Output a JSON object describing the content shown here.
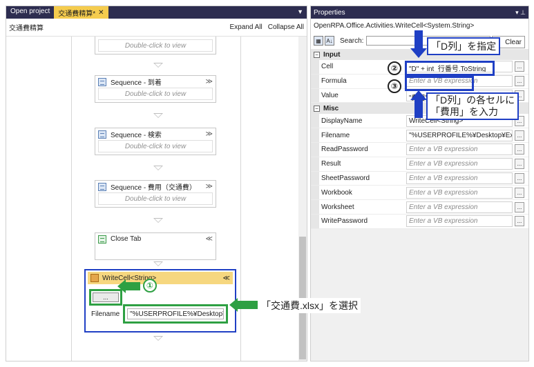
{
  "designer": {
    "tabs": [
      {
        "label": "Open project",
        "active": false
      },
      {
        "label": "交通費精算*",
        "active": true,
        "close": "✕"
      }
    ],
    "tab_dropdown": "▼",
    "breadcrumb": "交通費精算",
    "expand_all": "Expand All",
    "collapse_all": "Collapse All",
    "placeholder": "Double-click to view",
    "activities": [
      {
        "title": "",
        "body": "Double-click to view",
        "chevron": ""
      },
      {
        "title": "Sequence - 到着",
        "body": "Double-click to view",
        "chevron": "≫"
      },
      {
        "title": "Sequence - 検索",
        "body": "Double-click to view",
        "chevron": "≫"
      },
      {
        "title": "Sequence - 費用（交通費）",
        "body": "Double-click to view",
        "chevron": "≫"
      },
      {
        "title": "Close Tab",
        "body": "",
        "chevron": "≪"
      }
    ],
    "writecell": {
      "title": "WriteCell<String>",
      "chevron": "≪",
      "browse_label": "...",
      "filename_label": "Filename",
      "filename_value": "\"%USERPROFILE%¥Desktop¥Exc"
    }
  },
  "properties": {
    "title": "Properties",
    "pin": "▾ ⊥",
    "type_name": "OpenRPA.Office.Activities.WriteCell<System.String>",
    "search_label": "Search:",
    "clear_label": "Clear",
    "categories": [
      {
        "name": "Input",
        "expander": "−",
        "rows": [
          {
            "name": "Cell",
            "value": "\"D\" + int_行番号.ToString",
            "placeholder": false
          },
          {
            "name": "Formula",
            "value": "Enter a VB expression",
            "placeholder": true
          },
          {
            "name": "Value",
            "value": "\"費用\"",
            "placeholder": false
          }
        ]
      },
      {
        "name": "Misc",
        "expander": "−",
        "rows": [
          {
            "name": "DisplayName",
            "value": "WriteCell<String>",
            "placeholder": false
          },
          {
            "name": "Filename",
            "value": "\"%USERPROFILE%¥Desktop¥Exce",
            "placeholder": false
          },
          {
            "name": "ReadPassword",
            "value": "Enter a VB expression",
            "placeholder": true
          },
          {
            "name": "Result",
            "value": "Enter a VB expression",
            "placeholder": true
          },
          {
            "name": "SheetPassword",
            "value": "Enter a VB expression",
            "placeholder": true
          },
          {
            "name": "Workbook",
            "value": "Enter a VB expression",
            "placeholder": true
          },
          {
            "name": "Worksheet",
            "value": "Enter a VB expression",
            "placeholder": true
          },
          {
            "name": "WritePassword",
            "value": "Enter a VB expression",
            "placeholder": true
          }
        ]
      }
    ],
    "row_button": "..."
  },
  "annotations": {
    "badge1": "①",
    "badge2": "②",
    "badge3": "③",
    "note_d_column": "「D列」を指定",
    "note_cost_line1": "「D列」の各セルに",
    "note_cost_line2": "「費用」を入力",
    "note_select_file": "「交通費.xlsx」を選択",
    "color_blue": "#1f3fc4",
    "color_green": "#2ea043"
  }
}
